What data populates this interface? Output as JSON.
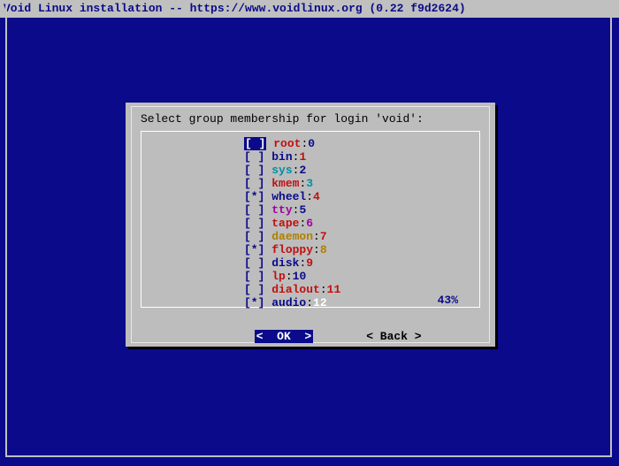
{
  "title": "Void Linux installation -- https://www.voidlinux.org (0.22 f9d2624)",
  "dialog": {
    "prompt": "Select group membership for login 'void':",
    "percent": "43%",
    "items": [
      {
        "checked": false,
        "name": "root",
        "id": "0",
        "selected": true,
        "name_color": "red",
        "id_color": "blue"
      },
      {
        "checked": false,
        "name": "bin",
        "id": "1",
        "selected": false,
        "name_color": "blue",
        "id_color": "red"
      },
      {
        "checked": false,
        "name": "sys",
        "id": "2",
        "selected": false,
        "name_color": "cyan",
        "id_color": "blue"
      },
      {
        "checked": false,
        "name": "kmem",
        "id": "3",
        "selected": false,
        "name_color": "red",
        "id_color": "cyan"
      },
      {
        "checked": true,
        "name": "wheel",
        "id": "4",
        "selected": false,
        "name_color": "blue",
        "id_color": "red"
      },
      {
        "checked": false,
        "name": "tty",
        "id": "5",
        "selected": false,
        "name_color": "magenta",
        "id_color": "blue"
      },
      {
        "checked": false,
        "name": "tape",
        "id": "6",
        "selected": false,
        "name_color": "red",
        "id_color": "magenta"
      },
      {
        "checked": false,
        "name": "daemon",
        "id": "7",
        "selected": false,
        "name_color": "yellow",
        "id_color": "red"
      },
      {
        "checked": true,
        "name": "floppy",
        "id": "8",
        "selected": false,
        "name_color": "red",
        "id_color": "yellow"
      },
      {
        "checked": false,
        "name": "disk",
        "id": "9",
        "selected": false,
        "name_color": "blue",
        "id_color": "red"
      },
      {
        "checked": false,
        "name": "lp",
        "id": "10",
        "selected": false,
        "name_color": "red",
        "id_color": "blue"
      },
      {
        "checked": false,
        "name": "dialout",
        "id": "11",
        "selected": false,
        "name_color": "red",
        "id_color": "red"
      },
      {
        "checked": true,
        "name": "audio",
        "id": "12",
        "selected": false,
        "name_color": "blue",
        "id_color": "white"
      }
    ]
  },
  "buttons": {
    "ok": "<  OK  >",
    "back": "< Back >"
  }
}
